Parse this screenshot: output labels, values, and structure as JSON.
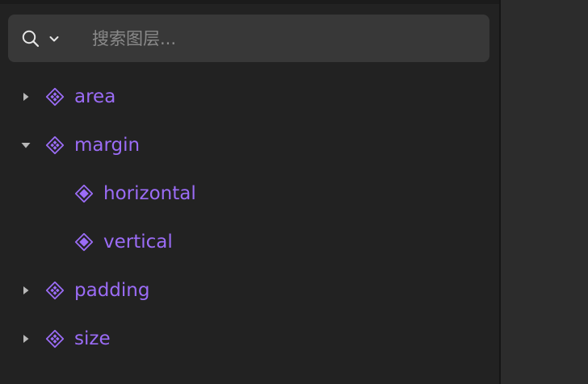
{
  "search": {
    "placeholder": "搜索图层...",
    "value": ""
  },
  "icons": {
    "search": "magnifier-icon",
    "search_dropdown": "chevron-down-icon",
    "expanded": "caret-down-icon",
    "collapsed": "caret-right-icon",
    "component_set": "component-set-icon",
    "component": "component-icon"
  },
  "colors": {
    "accent": "#9b6cf6",
    "panel_bg": "#222222",
    "search_bg": "#383838"
  },
  "layers": [
    {
      "name": "area",
      "level": 0,
      "expandable": true,
      "expanded": false,
      "kind": "component_set"
    },
    {
      "name": "margin",
      "level": 0,
      "expandable": true,
      "expanded": true,
      "kind": "component_set"
    },
    {
      "name": "horizontal",
      "level": 1,
      "expandable": false,
      "expanded": false,
      "kind": "component"
    },
    {
      "name": "vertical",
      "level": 1,
      "expandable": false,
      "expanded": false,
      "kind": "component"
    },
    {
      "name": "padding",
      "level": 0,
      "expandable": true,
      "expanded": false,
      "kind": "component_set"
    },
    {
      "name": "size",
      "level": 0,
      "expandable": true,
      "expanded": false,
      "kind": "component_set"
    }
  ]
}
